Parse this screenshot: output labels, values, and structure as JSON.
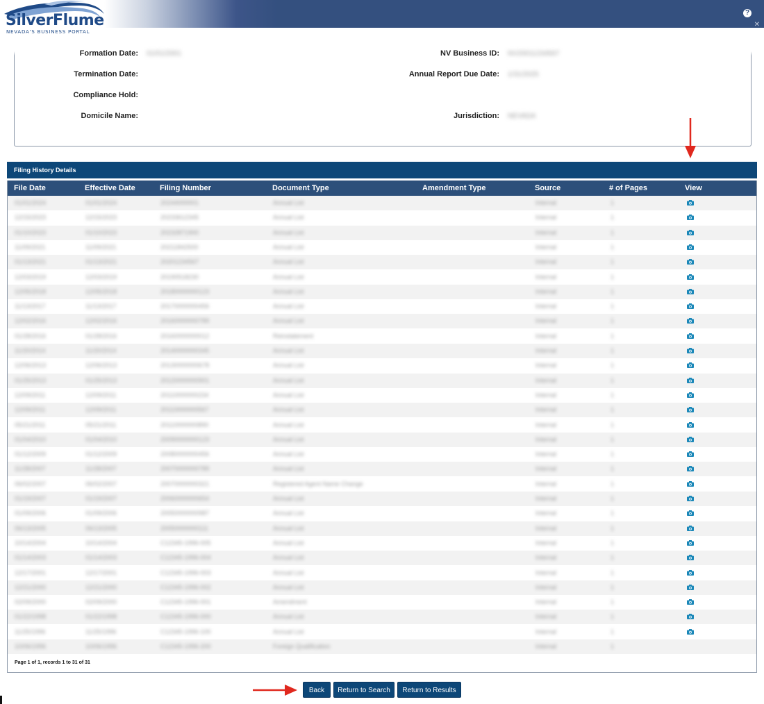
{
  "header": {
    "logo_text": "SilverFlume",
    "logo_tagline": "NEVADA'S BUSINESS PORTAL",
    "help_label": "?"
  },
  "entity_details": {
    "left": [
      {
        "label": "Formation Date:",
        "value": "01/01/2001"
      },
      {
        "label": "Termination Date:",
        "value": ""
      },
      {
        "label": "Compliance Hold:",
        "value": ""
      },
      {
        "label": "Domicile Name:",
        "value": ""
      }
    ],
    "right": [
      {
        "label": "NV Business ID:",
        "value": "NV20011234567"
      },
      {
        "label": "Annual Report Due Date:",
        "value": "1/31/2025"
      },
      {
        "label": "Jurisdiction:",
        "value": "NEVADA"
      }
    ]
  },
  "filing_history": {
    "title": "Filing History Details",
    "columns": [
      "File Date",
      "Effective Date",
      "Filing Number",
      "Document Type",
      "Amendment Type",
      "Source",
      "# of Pages",
      "View"
    ],
    "rows": [
      [
        "01/01/2024",
        "01/01/2024",
        "20244000001",
        "Annual List",
        "",
        "Internal",
        "1"
      ],
      [
        "12/15/2023",
        "12/15/2023",
        "20233612345",
        "Annual List",
        "",
        "Internal",
        "1"
      ],
      [
        "01/10/2023",
        "01/10/2023",
        "20232871900",
        "Annual List",
        "",
        "Internal",
        "1"
      ],
      [
        "11/09/2021",
        "11/09/2021",
        "20211842500",
        "Annual List",
        "",
        "Internal",
        "1"
      ],
      [
        "01/13/2021",
        "01/13/2021",
        "20201234567",
        "Annual List",
        "",
        "Internal",
        "1"
      ],
      [
        "12/03/2019",
        "12/03/2019",
        "20190518230",
        "Annual List",
        "",
        "Internal",
        "1"
      ],
      [
        "12/05/2018",
        "12/05/2018",
        "20180000000123",
        "Annual List",
        "",
        "Internal",
        "1"
      ],
      [
        "11/13/2017",
        "11/13/2017",
        "20170000000456",
        "Annual List",
        "",
        "Internal",
        "1"
      ],
      [
        "12/02/2016",
        "12/02/2016",
        "20160000000789",
        "Annual List",
        "",
        "Internal",
        "1"
      ],
      [
        "01/28/2016",
        "01/28/2016",
        "20160000000012",
        "Reinstatement",
        "",
        "Internal",
        "1"
      ],
      [
        "11/20/2014",
        "11/20/2014",
        "20140000000345",
        "Annual List",
        "",
        "Internal",
        "1"
      ],
      [
        "12/06/2013",
        "12/06/2013",
        "20130000000678",
        "Annual List",
        "",
        "Internal",
        "1"
      ],
      [
        "01/25/2013",
        "01/25/2013",
        "20120000000901",
        "Annual List",
        "",
        "Internal",
        "1"
      ],
      [
        "12/09/2011",
        "12/09/2011",
        "20110000000234",
        "Annual List",
        "",
        "Internal",
        "1"
      ],
      [
        "12/09/2011",
        "12/09/2011",
        "20110000000567",
        "Annual List",
        "",
        "Internal",
        "1"
      ],
      [
        "05/21/2011",
        "05/21/2011",
        "20110000000890",
        "Annual List",
        "",
        "Internal",
        "1"
      ],
      [
        "01/04/2010",
        "01/04/2010",
        "20090000000123",
        "Annual List",
        "",
        "Internal",
        "1"
      ],
      [
        "01/12/2009",
        "01/12/2009",
        "20080000000456",
        "Annual List",
        "",
        "Internal",
        "1"
      ],
      [
        "11/28/2007",
        "11/28/2007",
        "20070000000789",
        "Annual List",
        "",
        "Internal",
        "1"
      ],
      [
        "06/02/2007",
        "06/02/2007",
        "20070000000321",
        "Registered Agent Name Change",
        "",
        "Internal",
        "1"
      ],
      [
        "01/19/2007",
        "01/19/2007",
        "20060000000654",
        "Annual List",
        "",
        "Internal",
        "1"
      ],
      [
        "01/09/2006",
        "01/09/2006",
        "20050000000987",
        "Annual List",
        "",
        "Internal",
        "1"
      ],
      [
        "06/13/2005",
        "06/13/2005",
        "20050000000111",
        "Annual List",
        "",
        "Internal",
        "1"
      ],
      [
        "10/14/2004",
        "10/14/2004",
        "C12345-1996-005",
        "Annual List",
        "",
        "Internal",
        "1"
      ],
      [
        "01/14/2003",
        "01/14/2003",
        "C12345-1996-004",
        "Annual List",
        "",
        "Internal",
        "1"
      ],
      [
        "12/17/2001",
        "12/17/2001",
        "C12345-1996-003",
        "Annual List",
        "",
        "Internal",
        "1"
      ],
      [
        "12/21/2000",
        "12/21/2000",
        "C12345-1996-002",
        "Annual List",
        "",
        "Internal",
        "1"
      ],
      [
        "02/09/2000",
        "02/09/2000",
        "C12345-1996-001",
        "Amendment",
        "",
        "Internal",
        "1"
      ],
      [
        "01/22/1998",
        "01/22/1998",
        "C12345-1996-000",
        "Annual List",
        "",
        "Internal",
        "1"
      ],
      [
        "11/25/1996",
        "11/25/1996",
        "C12345-1996-100",
        "Annual List",
        "",
        "Internal",
        "1"
      ],
      [
        "10/06/1996",
        "10/06/1996",
        "C12345-1996-200",
        "Foreign Qualification",
        "",
        "Internal",
        "1"
      ]
    ],
    "pager_text": "Page 1 of 1, records 1 to 31 of 31"
  },
  "buttons": {
    "back": "Back",
    "return_search": "Return to Search",
    "return_results": "Return to Results"
  },
  "colors": {
    "header_blue": "#34507f",
    "section_blue": "#0d4778",
    "table_header": "#2c4f7a",
    "icon_teal": "#1a87b8",
    "annotation_red": "#e0281e"
  },
  "icons": {
    "view": "camera-icon",
    "help": "question-circle-icon"
  }
}
